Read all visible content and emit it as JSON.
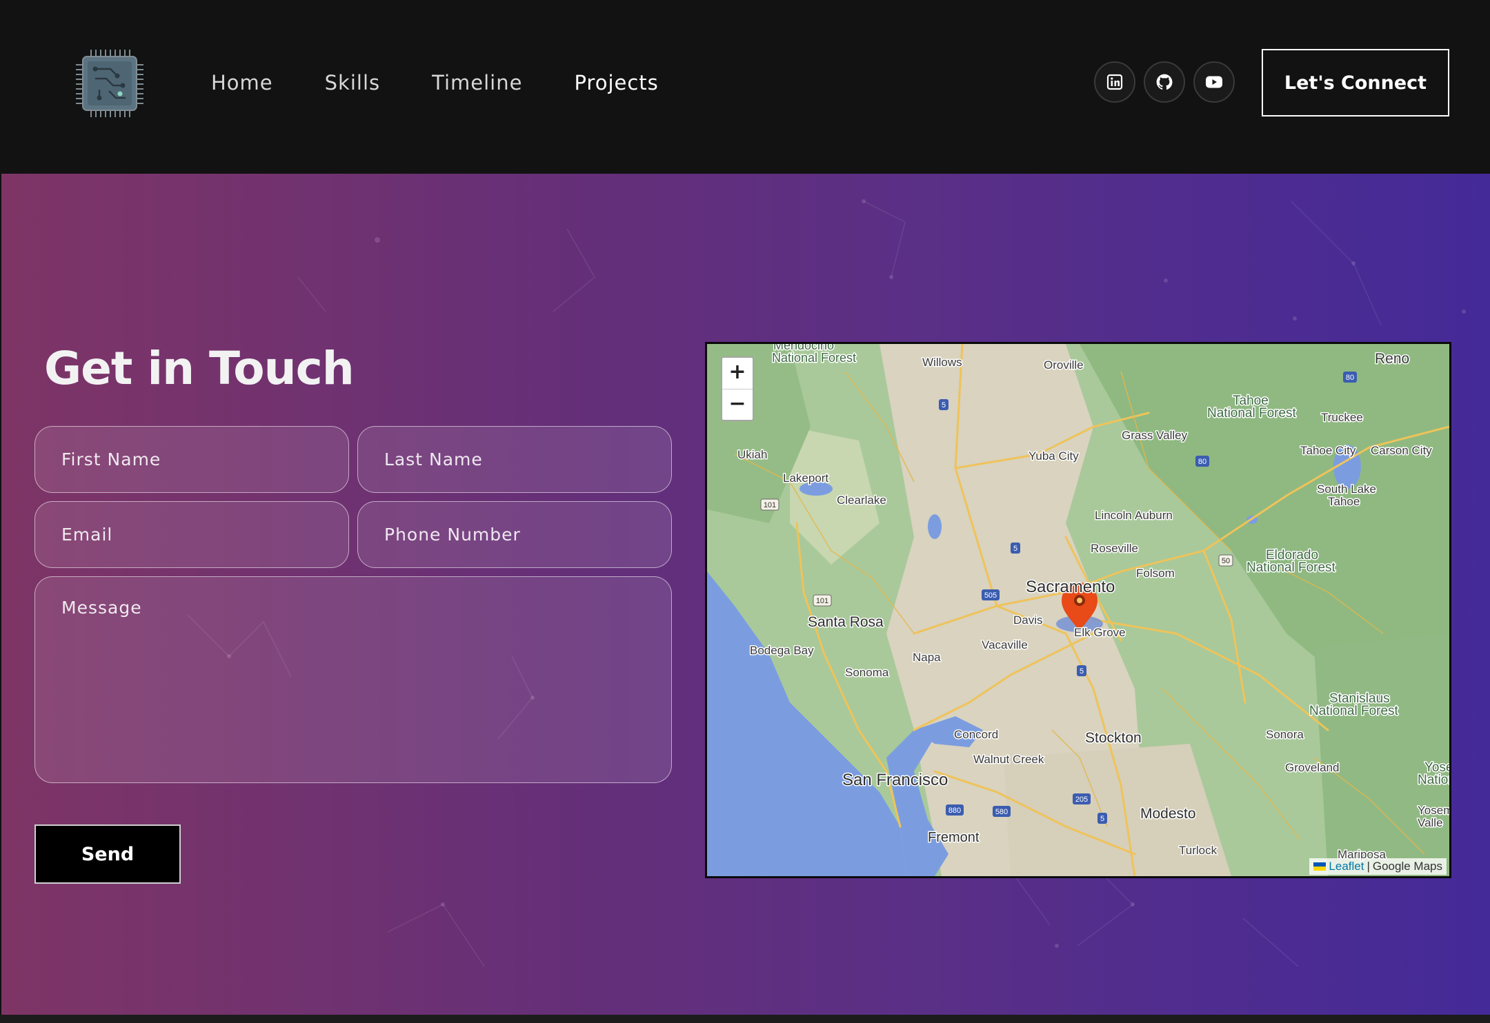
{
  "header": {
    "logo_icon": "cpu-chip-logo",
    "nav": [
      "Home",
      "Skills",
      "Timeline",
      "Projects"
    ],
    "active_nav": "Projects",
    "social_icons": [
      "linkedin-icon",
      "github-icon",
      "youtube-icon"
    ],
    "connect_label": "Let's Connect"
  },
  "contact": {
    "title": "Get in Touch",
    "fields": {
      "first_name": "First Name",
      "last_name": "Last Name",
      "email": "Email",
      "phone": "Phone Number",
      "message": "Message"
    },
    "send_label": "Send"
  },
  "map": {
    "zoom_in": "+",
    "zoom_out": "−",
    "attribution_link": "Leaflet",
    "attribution_sep": " | ",
    "attribution_text": "Google Maps",
    "marker": "Elk Grove",
    "labels": {
      "mendocino": "Mendocino",
      "mendocino_nf": "National Forest",
      "willows": "Willows",
      "oroville": "Oroville",
      "reno": "Reno",
      "tahoe1": "Tahoe",
      "tahoe2": "National Forest",
      "truckee": "Truckee",
      "grass_valley": "Grass Valley",
      "tahoe_city": "Tahoe City",
      "carson_city": "Carson City",
      "ukiah": "Ukiah",
      "yuba_city": "Yuba City",
      "lakeport": "Lakeport",
      "clearlake": "Clearlake",
      "south_lake1": "South Lake",
      "south_lake2": "Tahoe",
      "lincoln": "Lincoln",
      "auburn": "Auburn",
      "roseville": "Roseville",
      "eldorado1": "Eldorado",
      "eldorado2": "National Forest",
      "folsom": "Folsom",
      "sacramento": "Sacramento",
      "santa_rosa": "Santa Rosa",
      "davis": "Davis",
      "elk_grove": "Elk Grove",
      "bodega_bay": "Bodega Bay",
      "napa": "Napa",
      "vacaville": "Vacaville",
      "sonoma": "Sonoma",
      "stanislaus1": "Stanislaus",
      "stanislaus2": "National Forest",
      "concord": "Concord",
      "stockton": "Stockton",
      "sonora": "Sonora",
      "walnut_creek": "Walnut Creek",
      "groveland": "Groveland",
      "yose1": "Yose",
      "yose2": "Nation",
      "san_francisco": "San Francisco",
      "modesto": "Modesto",
      "yosem1": "Yosem",
      "yosem2": "Valle",
      "fremont": "Fremont",
      "turlock": "Turlock",
      "mariposa": "Mariposa",
      "hw5a": "5",
      "hw80a": "80",
      "hw80b": "80",
      "hw101a": "101",
      "hw101b": "101",
      "hw505": "505",
      "hw5b": "5",
      "hw50": "50",
      "hw5c": "5",
      "hw880": "880",
      "hw580": "580",
      "hw205": "205",
      "hw5d": "5"
    }
  }
}
